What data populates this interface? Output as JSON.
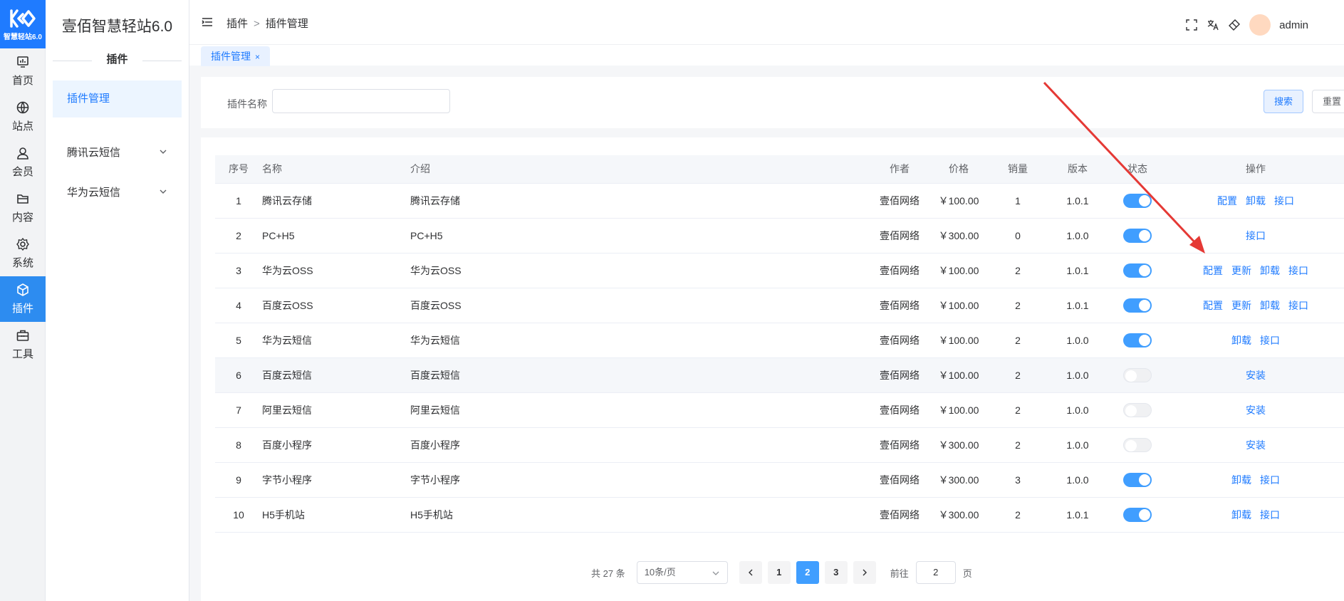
{
  "brand": {
    "logo_sub": "智慧轻站6.0",
    "title": "壹佰智慧轻站6.0",
    "section": "插件"
  },
  "rail": [
    {
      "label": "首页",
      "icon": "monitor-icon"
    },
    {
      "label": "站点",
      "icon": "globe-icon"
    },
    {
      "label": "会员",
      "icon": "user-icon"
    },
    {
      "label": "内容",
      "icon": "folder-icon"
    },
    {
      "label": "系统",
      "icon": "gear-icon"
    },
    {
      "label": "插件",
      "icon": "cube-icon",
      "active": true
    },
    {
      "label": "工具",
      "icon": "toolbox-icon"
    }
  ],
  "sidebar": {
    "items": [
      {
        "label": "插件管理"
      },
      {
        "label": "腾讯云短信"
      },
      {
        "label": "华为云短信"
      }
    ]
  },
  "header": {
    "crumb_1": "插件",
    "crumb_sep": ">",
    "crumb_2": "插件管理",
    "user": "admin"
  },
  "tabs": [
    {
      "label": "插件管理",
      "close": "×"
    }
  ],
  "search": {
    "label": "插件名称",
    "value": "",
    "placeholder": "",
    "search_btn": "搜索",
    "reset_btn": "重置"
  },
  "table": {
    "headers": [
      "序号",
      "名称",
      "介绍",
      "作者",
      "价格",
      "销量",
      "版本",
      "状态",
      "操作"
    ],
    "rows": [
      {
        "no": "1",
        "name": "腾讯云存储",
        "intro": "腾讯云存储",
        "author": "壹佰网络",
        "price": "￥100.00",
        "sales": "1",
        "version": "1.0.1",
        "on": true,
        "ops": [
          "配置",
          "卸载",
          "接口"
        ]
      },
      {
        "no": "2",
        "name": "PC+H5",
        "intro": "PC+H5",
        "author": "壹佰网络",
        "price": "￥300.00",
        "sales": "0",
        "version": "1.0.0",
        "on": true,
        "ops": [
          "接口"
        ]
      },
      {
        "no": "3",
        "name": "华为云OSS",
        "intro": "华为云OSS",
        "author": "壹佰网络",
        "price": "￥100.00",
        "sales": "2",
        "version": "1.0.1",
        "on": true,
        "ops": [
          "配置",
          "更新",
          "卸载",
          "接口"
        ]
      },
      {
        "no": "4",
        "name": "百度云OSS",
        "intro": "百度云OSS",
        "author": "壹佰网络",
        "price": "￥100.00",
        "sales": "2",
        "version": "1.0.1",
        "on": true,
        "ops": [
          "配置",
          "更新",
          "卸载",
          "接口"
        ]
      },
      {
        "no": "5",
        "name": "华为云短信",
        "intro": "华为云短信",
        "author": "壹佰网络",
        "price": "￥100.00",
        "sales": "2",
        "version": "1.0.0",
        "on": true,
        "ops": [
          "卸载",
          "接口"
        ]
      },
      {
        "no": "6",
        "name": "百度云短信",
        "intro": "百度云短信",
        "author": "壹佰网络",
        "price": "￥100.00",
        "sales": "2",
        "version": "1.0.0",
        "on": false,
        "ops": [
          "安装"
        ],
        "highlight": true
      },
      {
        "no": "7",
        "name": "阿里云短信",
        "intro": "阿里云短信",
        "author": "壹佰网络",
        "price": "￥100.00",
        "sales": "2",
        "version": "1.0.0",
        "on": false,
        "ops": [
          "安装"
        ]
      },
      {
        "no": "8",
        "name": "百度小程序",
        "intro": "百度小程序",
        "author": "壹佰网络",
        "price": "￥300.00",
        "sales": "2",
        "version": "1.0.0",
        "on": false,
        "ops": [
          "安装"
        ]
      },
      {
        "no": "9",
        "name": "字节小程序",
        "intro": "字节小程序",
        "author": "壹佰网络",
        "price": "￥300.00",
        "sales": "3",
        "version": "1.0.0",
        "on": true,
        "ops": [
          "卸载",
          "接口"
        ]
      },
      {
        "no": "10",
        "name": "H5手机站",
        "intro": "H5手机站",
        "author": "壹佰网络",
        "price": "￥300.00",
        "sales": "2",
        "version": "1.0.1",
        "on": true,
        "ops": [
          "卸载",
          "接口"
        ]
      }
    ]
  },
  "pagination": {
    "total": "共 27 条",
    "page_size": "10条/页",
    "pages": [
      "1",
      "2",
      "3"
    ],
    "current": "2",
    "goto_label": "前往",
    "goto_value": "2",
    "page_unit": "页"
  },
  "colors": {
    "primary": "#1f7bff",
    "switch_on": "#409eff",
    "arrow": "#e53935"
  }
}
